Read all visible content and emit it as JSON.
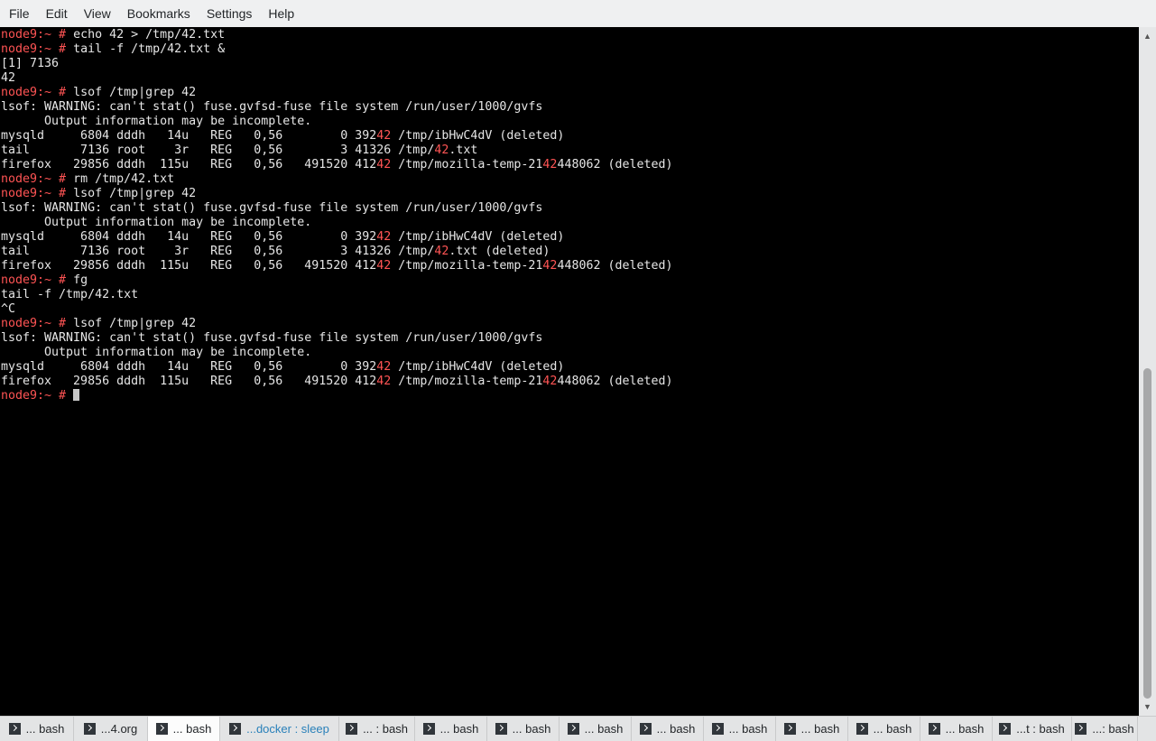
{
  "menubar": {
    "items": [
      "File",
      "Edit",
      "View",
      "Bookmarks",
      "Settings",
      "Help"
    ]
  },
  "terminal": {
    "lines": [
      [
        {
          "t": "node9:~ # ",
          "c": "prompt"
        },
        {
          "t": "echo 42 > /tmp/42.txt"
        }
      ],
      [
        {
          "t": "node9:~ # ",
          "c": "prompt"
        },
        {
          "t": "tail -f /tmp/42.txt &"
        }
      ],
      [
        {
          "t": "[1] 7136"
        }
      ],
      [
        {
          "t": "42"
        }
      ],
      [
        {
          "t": "node9:~ # ",
          "c": "prompt"
        },
        {
          "t": "lsof /tmp|grep 42"
        }
      ],
      [
        {
          "t": "lsof: WARNING: can't stat() fuse.gvfsd-fuse file system /run/user/1000/gvfs"
        }
      ],
      [
        {
          "t": "      Output information may be incomplete."
        }
      ],
      [
        {
          "t": "mysqld     6804 dddh   14u   REG   0,56        0 392"
        },
        {
          "t": "42",
          "c": "hl"
        },
        {
          "t": " /tmp/ibHwC4dV (deleted)"
        }
      ],
      [
        {
          "t": "tail       7136 root    3r   REG   0,56        3 41326 /tmp/"
        },
        {
          "t": "42",
          "c": "hl"
        },
        {
          "t": ".txt"
        }
      ],
      [
        {
          "t": "firefox   29856 dddh  115u   REG   0,56   491520 412"
        },
        {
          "t": "42",
          "c": "hl"
        },
        {
          "t": " /tmp/mozilla-temp-21"
        },
        {
          "t": "42",
          "c": "hl"
        },
        {
          "t": "448062 (deleted)"
        }
      ],
      [
        {
          "t": "node9:~ # ",
          "c": "prompt"
        },
        {
          "t": "rm /tmp/42.txt"
        }
      ],
      [
        {
          "t": "node9:~ # ",
          "c": "prompt"
        },
        {
          "t": "lsof /tmp|grep 42"
        }
      ],
      [
        {
          "t": "lsof: WARNING: can't stat() fuse.gvfsd-fuse file system /run/user/1000/gvfs"
        }
      ],
      [
        {
          "t": "      Output information may be incomplete."
        }
      ],
      [
        {
          "t": "mysqld     6804 dddh   14u   REG   0,56        0 392"
        },
        {
          "t": "42",
          "c": "hl"
        },
        {
          "t": " /tmp/ibHwC4dV (deleted)"
        }
      ],
      [
        {
          "t": "tail       7136 root    3r   REG   0,56        3 41326 /tmp/"
        },
        {
          "t": "42",
          "c": "hl"
        },
        {
          "t": ".txt (deleted)"
        }
      ],
      [
        {
          "t": "firefox   29856 dddh  115u   REG   0,56   491520 412"
        },
        {
          "t": "42",
          "c": "hl"
        },
        {
          "t": " /tmp/mozilla-temp-21"
        },
        {
          "t": "42",
          "c": "hl"
        },
        {
          "t": "448062 (deleted)"
        }
      ],
      [
        {
          "t": "node9:~ # ",
          "c": "prompt"
        },
        {
          "t": "fg"
        }
      ],
      [
        {
          "t": "tail -f /tmp/42.txt"
        }
      ],
      [
        {
          "t": "^C"
        }
      ],
      [
        {
          "t": "node9:~ # ",
          "c": "prompt"
        },
        {
          "t": "lsof /tmp|grep 42"
        }
      ],
      [
        {
          "t": "lsof: WARNING: can't stat() fuse.gvfsd-fuse file system /run/user/1000/gvfs"
        }
      ],
      [
        {
          "t": "      Output information may be incomplete."
        }
      ],
      [
        {
          "t": "mysqld     6804 dddh   14u   REG   0,56        0 392"
        },
        {
          "t": "42",
          "c": "hl"
        },
        {
          "t": " /tmp/ibHwC4dV (deleted)"
        }
      ],
      [
        {
          "t": "firefox   29856 dddh  115u   REG   0,56   491520 412"
        },
        {
          "t": "42",
          "c": "hl"
        },
        {
          "t": " /tmp/mozilla-temp-21"
        },
        {
          "t": "42",
          "c": "hl"
        },
        {
          "t": "448062 (deleted)"
        }
      ],
      [
        {
          "t": "node9:~ # ",
          "c": "prompt"
        },
        {
          "t": "",
          "cursor": true
        }
      ]
    ]
  },
  "tabs": [
    {
      "label": "... bash",
      "state": "normal"
    },
    {
      "label": "...4.org",
      "state": "normal"
    },
    {
      "label": "... bash",
      "state": "active"
    },
    {
      "label": "...docker : sleep",
      "state": "activity"
    },
    {
      "label": "... : bash",
      "state": "normal"
    },
    {
      "label": "... bash",
      "state": "normal"
    },
    {
      "label": "... bash",
      "state": "normal"
    },
    {
      "label": "... bash",
      "state": "normal"
    },
    {
      "label": "... bash",
      "state": "normal"
    },
    {
      "label": "... bash",
      "state": "normal"
    },
    {
      "label": "... bash",
      "state": "normal"
    },
    {
      "label": "... bash",
      "state": "normal"
    },
    {
      "label": "... bash",
      "state": "normal"
    },
    {
      "label": "...t : bash",
      "state": "normal"
    },
    {
      "label": "...: bash",
      "state": "normal"
    }
  ]
}
